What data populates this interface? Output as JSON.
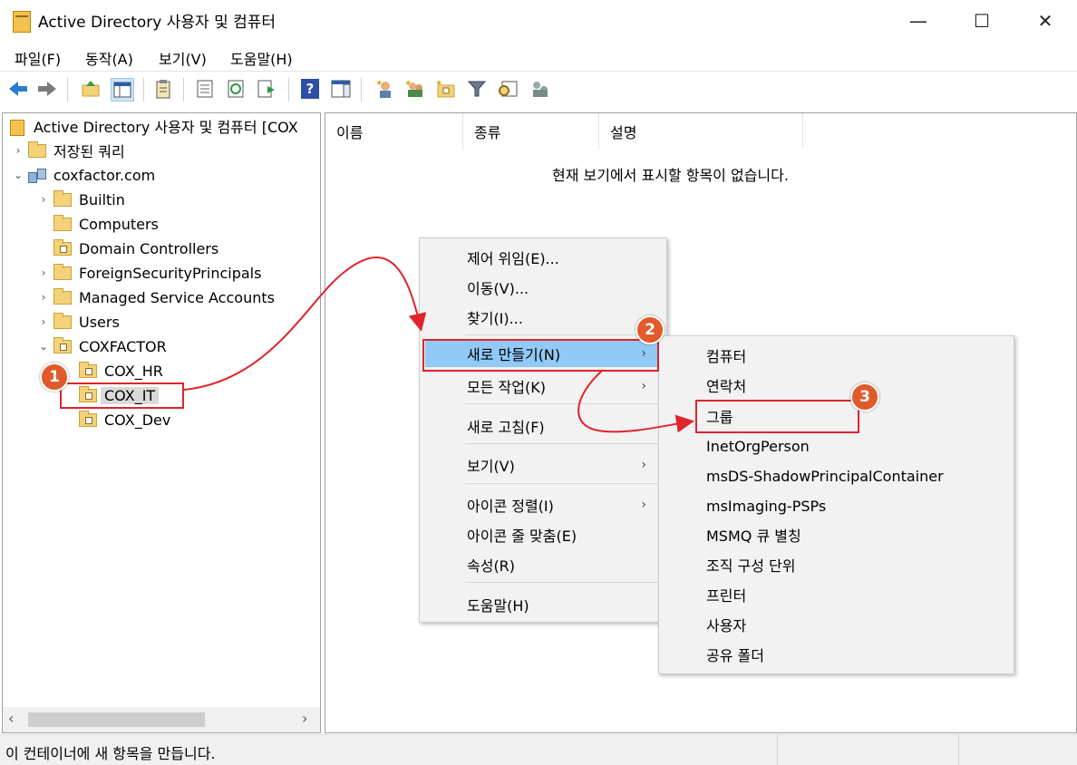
{
  "window": {
    "title": "Active Directory 사용자 및 컴퓨터",
    "minimize": "—",
    "maximize": "☐",
    "close": "✕"
  },
  "menubar": [
    "파일(F)",
    "동작(A)",
    "보기(V)",
    "도움말(H)"
  ],
  "toolbar": {
    "icons": [
      "back-icon",
      "forward-icon",
      "up-folder-icon",
      "show-hide-tree-icon",
      "clipboard-icon",
      "properties-icon",
      "refresh-icon",
      "export-list-icon",
      "help-icon",
      "action-pane-icon",
      "new-user-icon",
      "new-group-icon",
      "new-ou-icon",
      "filter-icon",
      "find-icon",
      "add-to-group-icon"
    ],
    "help_glyph": "?"
  },
  "tree": {
    "root": "Active Directory 사용자 및 컴퓨터 [COX",
    "saved_queries": "저장된 쿼리",
    "domain": "coxfactor.com",
    "items": [
      "Builtin",
      "Computers",
      "Domain Controllers",
      "ForeignSecurityPrincipals",
      "Managed Service Accounts",
      "Users",
      "COXFACTOR"
    ],
    "ou_children": [
      "COX_HR",
      "COX_IT",
      "COX_Dev"
    ]
  },
  "list": {
    "columns": [
      "이름",
      "종류",
      "설명"
    ],
    "empty_message": "현재 보기에서 표시할 항목이 없습니다."
  },
  "context_menu": {
    "items": [
      "제어 위임(E)...",
      "이동(V)...",
      "찾기(I)...",
      "새로 만들기(N)",
      "모든 작업(K)",
      "새로 고침(F)",
      "보기(V)",
      "아이콘 정렬(I)",
      "아이콘 줄 맞춤(E)",
      "속성(R)",
      "도움말(H)"
    ],
    "arrow": "›"
  },
  "submenu": {
    "items": [
      "컴퓨터",
      "연락처",
      "그룹",
      "InetOrgPerson",
      "msDS-ShadowPrincipalContainer",
      "msImaging-PSPs",
      "MSMQ 큐 별칭",
      "조직 구성 단위",
      "프린터",
      "사용자",
      "공유 폴더"
    ]
  },
  "annotations": {
    "badges": [
      "1",
      "2",
      "3"
    ],
    "color": "#e0242b"
  },
  "scroll": {
    "left": "‹",
    "right": "›"
  },
  "status": {
    "text": "이 컨테이너에 새 항목을 만듭니다."
  }
}
